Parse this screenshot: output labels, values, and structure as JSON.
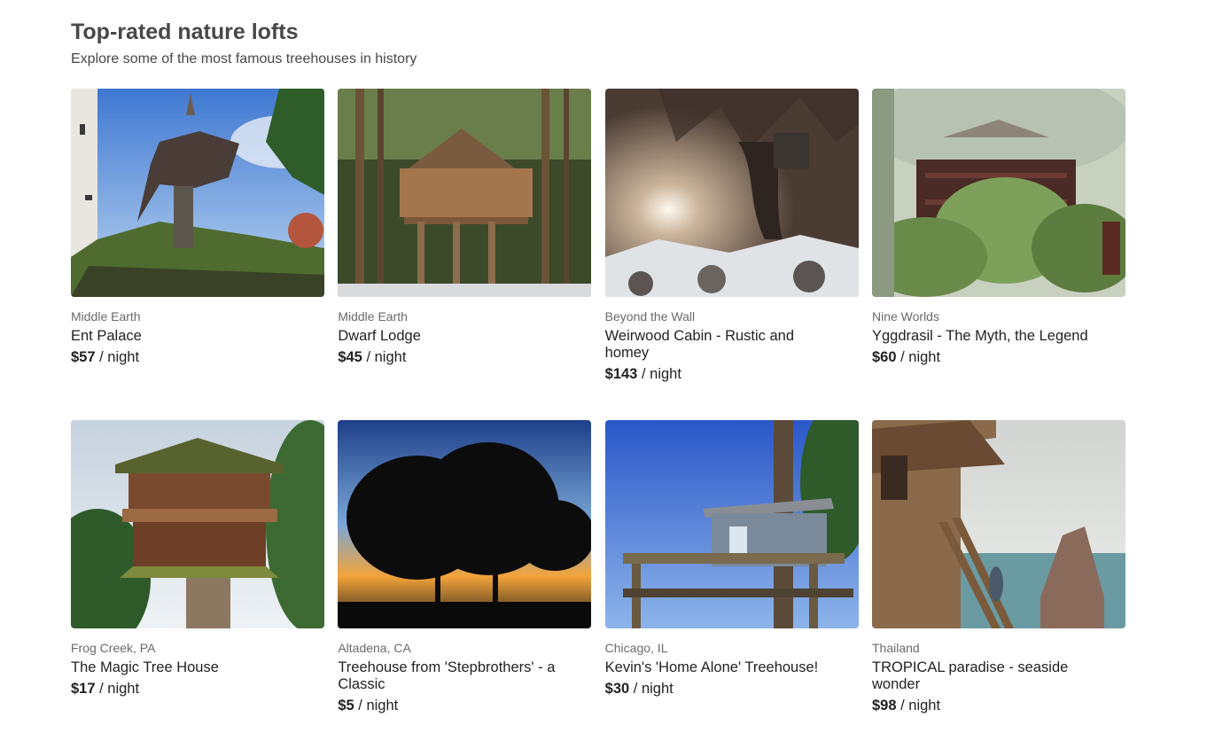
{
  "header": {
    "title": "Top-rated nature lofts",
    "subtitle": "Explore some of the most famous treehouses in history"
  },
  "listings": [
    {
      "location": "Middle Earth",
      "title": "Ent Palace",
      "price": "$57",
      "unit": "/ night"
    },
    {
      "location": "Middle Earth",
      "title": "Dwarf Lodge",
      "price": "$45",
      "unit": "/ night"
    },
    {
      "location": "Beyond the Wall",
      "title": "Weirwood Cabin - Rustic and homey",
      "price": "$143",
      "unit": "/ night"
    },
    {
      "location": "Nine Worlds",
      "title": "Yggdrasil - The Myth, the Legend",
      "price": "$60",
      "unit": "/ night"
    },
    {
      "location": "Frog Creek, PA",
      "title": "The Magic Tree House",
      "price": "$17",
      "unit": "/ night"
    },
    {
      "location": "Altadena, CA",
      "title": "Treehouse from 'Stepbrothers' - a Classic",
      "price": "$5",
      "unit": "/ night"
    },
    {
      "location": "Chicago, IL",
      "title": "Kevin's 'Home Alone' Treehouse!",
      "price": "$30",
      "unit": "/ night"
    },
    {
      "location": "Thailand",
      "title": "TROPICAL paradise - seaside wonder",
      "price": "$98",
      "unit": "/ night"
    }
  ]
}
